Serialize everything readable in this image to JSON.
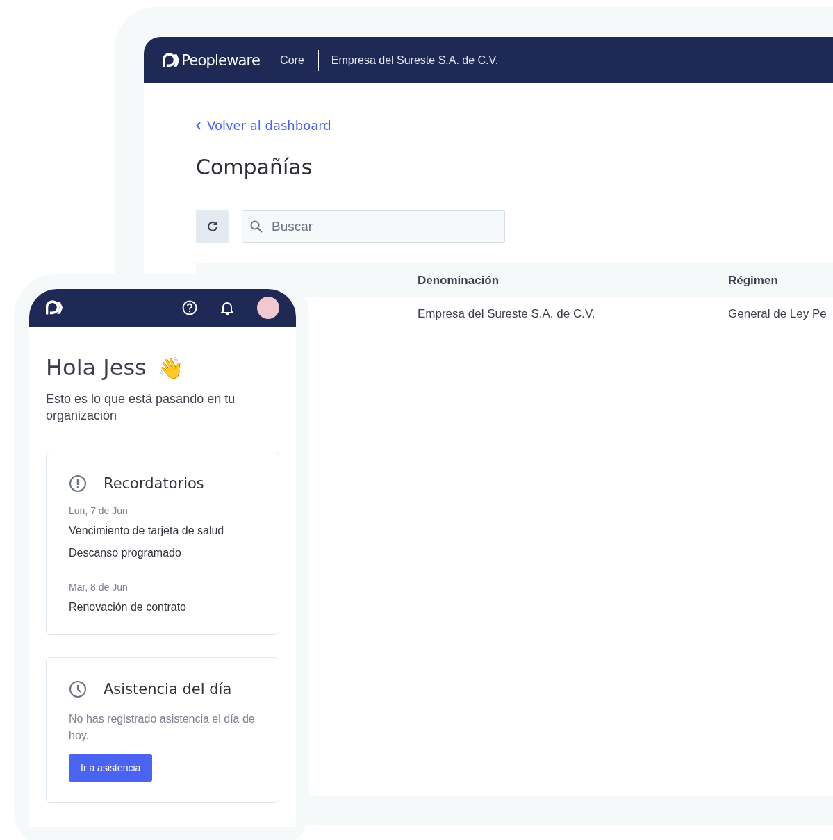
{
  "desktop": {
    "header": {
      "brand": "Peopleware",
      "module": "Core",
      "company": "Empresa del Sureste S.A. de C.V."
    },
    "back_link": "Volver al dashboard",
    "title": "Compañías",
    "search": {
      "placeholder": "Buscar"
    },
    "table": {
      "columns": [
        "Denominación",
        "Régimen"
      ],
      "rows": [
        [
          "Empresa del Sureste S.A. de C.V.",
          "General de Ley Pe"
        ]
      ]
    }
  },
  "mobile": {
    "greeting": "Hola Jess",
    "emoji": "👋",
    "subtitle": "Esto es lo que está pasando en tu organización",
    "reminders": {
      "title": "Recordatorios",
      "groups": [
        {
          "date": "Lun, 7 de Jun",
          "items": [
            "Vencimiento de tarjeta de salud",
            "Descanso programado"
          ]
        },
        {
          "date": "Mar, 8 de Jun",
          "items": [
            "Renovación de contrato"
          ]
        }
      ]
    },
    "attendance": {
      "title": "Asistencia del día",
      "message": "No has registrado asistencia el día de hoy.",
      "button": "Ir a asistencia"
    }
  }
}
